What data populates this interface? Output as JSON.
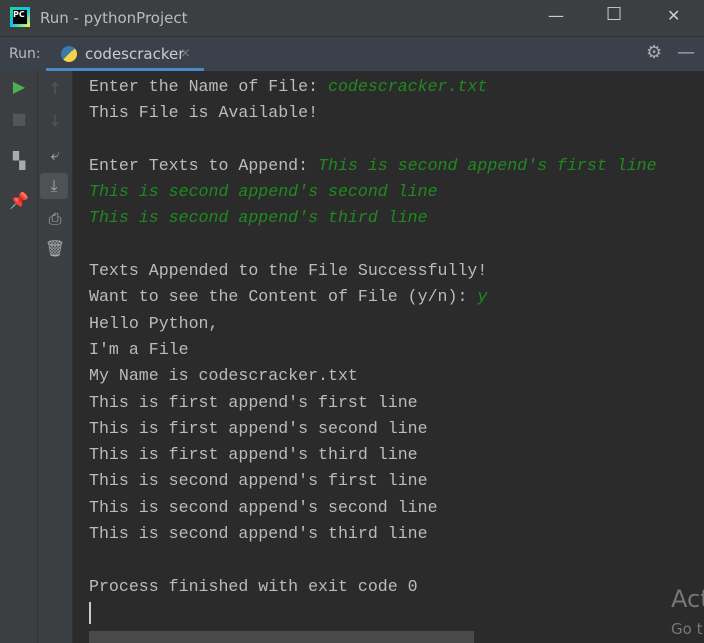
{
  "window": {
    "title": "Run - pythonProject",
    "logo": "PC"
  },
  "run_bar": {
    "label": "Run:",
    "tab": "codescracker",
    "close": "×"
  },
  "console": {
    "lines": [
      {
        "prompt": "Enter the Name of File: ",
        "input": "codescracker.txt"
      },
      {
        "prompt": "This File is Available!",
        "input": ""
      },
      {
        "prompt": "",
        "input": ""
      },
      {
        "prompt": "Enter Texts to Append: ",
        "input": "This is second append's first line"
      },
      {
        "prompt": "",
        "input": "This is second append's second line"
      },
      {
        "prompt": "",
        "input": "This is second append's third line"
      },
      {
        "prompt": "",
        "input": ""
      },
      {
        "prompt": "Texts Appended to the File Successfully!",
        "input": ""
      },
      {
        "prompt": "Want to see the Content of File (y/n): ",
        "input": "y"
      },
      {
        "prompt": "Hello Python,",
        "input": ""
      },
      {
        "prompt": "I'm a File",
        "input": ""
      },
      {
        "prompt": "My Name is codescracker.txt",
        "input": ""
      },
      {
        "prompt": "This is first append's first line",
        "input": ""
      },
      {
        "prompt": "This is first append's second line",
        "input": ""
      },
      {
        "prompt": "This is first append's third line",
        "input": ""
      },
      {
        "prompt": "This is second append's first line",
        "input": ""
      },
      {
        "prompt": "This is second append's second line",
        "input": ""
      },
      {
        "prompt": "This is second append's third line",
        "input": ""
      },
      {
        "prompt": "",
        "input": ""
      },
      {
        "prompt": "Process finished with exit code 0",
        "input": ""
      }
    ]
  },
  "watermark": {
    "line1": "Act",
    "line2": "Go t"
  }
}
